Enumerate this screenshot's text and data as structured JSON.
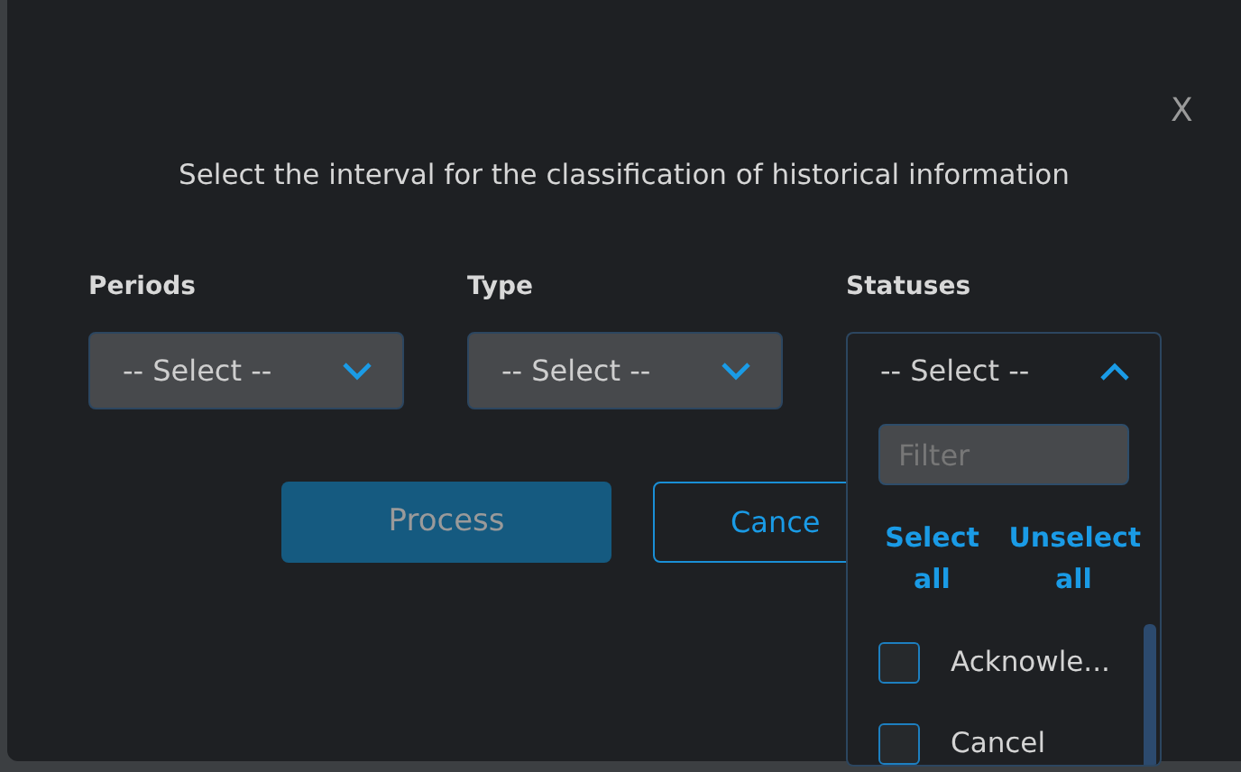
{
  "dialog": {
    "close": "X",
    "title": "Select the interval for the classification of historical information"
  },
  "fields": [
    {
      "label": "Periods",
      "value": "-- Select --",
      "expanded": false
    },
    {
      "label": "Type",
      "value": "-- Select --",
      "expanded": false
    },
    {
      "label": "Statuses",
      "value": "-- Select --",
      "expanded": true
    }
  ],
  "buttons": [
    {
      "label": "Process",
      "kind": "primary",
      "disabled": true
    },
    {
      "label": "Cance",
      "kind": "outline",
      "disabled": false
    }
  ],
  "dropdown": {
    "filter": {
      "placeholder": "Filter"
    },
    "select_all": "Select all",
    "unselect_all": "Unselect all",
    "options": [
      {
        "label": "Acknowle...",
        "checked": false
      },
      {
        "label": "Cancel",
        "checked": false
      }
    ]
  }
}
